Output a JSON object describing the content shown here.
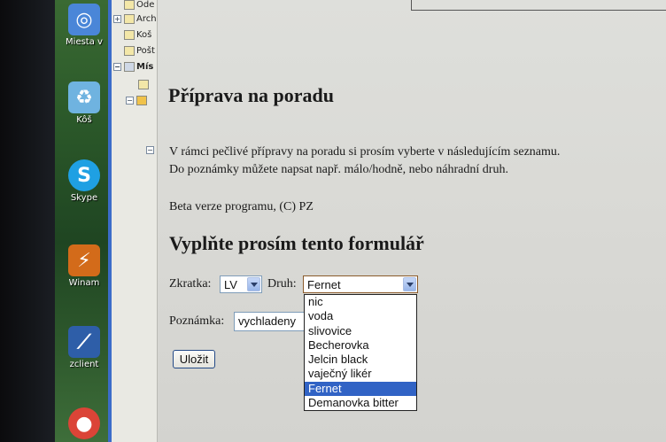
{
  "desktop": {
    "icons": [
      {
        "label": "Miesta v",
        "icon": "network-places-icon",
        "color": "#4a86d8"
      },
      {
        "label": "Kôš",
        "icon": "recycle-bin-icon",
        "color": "#6fb3e0"
      },
      {
        "label": "Skype",
        "icon": "skype-icon",
        "color": "#1fa0e3"
      },
      {
        "label": "Winam",
        "icon": "winamp-icon",
        "color": "#d36b1a"
      },
      {
        "label": "zclient",
        "icon": "zclient-icon",
        "color": "#2e5ea8"
      },
      {
        "label": "",
        "icon": "chrome-icon",
        "color": "#db4437"
      }
    ]
  },
  "tree": {
    "items": [
      {
        "label": "Ode",
        "expander": ""
      },
      {
        "label": "Arch",
        "expander": "+"
      },
      {
        "label": "Koš",
        "expander": ""
      },
      {
        "label": "Pošt",
        "expander": ""
      },
      {
        "label": "Mís",
        "expander": "−"
      },
      {
        "label": "",
        "expander": ""
      },
      {
        "label": "",
        "expander": "−"
      }
    ]
  },
  "page": {
    "title": "Příprava na poradu",
    "intro_line1": "V rámci pečlivé přípravy na poradu si prosím vyberte v následujícím seznamu.",
    "intro_line2": "Do poznámky můžete napsat např. málo/hodně, nebo náhradní druh.",
    "beta_note": "Beta verze programu, (C) PZ",
    "form_heading": "Vyplňte prosím tento formulář"
  },
  "form": {
    "zkratka_label": "Zkratka:",
    "zkratka_value": "LV",
    "druh_label": "Druh:",
    "druh_value": "Fernet",
    "druh_options": [
      "nic",
      "voda",
      "slivovice",
      "Becherovka",
      "Jelcin black",
      "vaječný likér",
      "Fernet",
      "Demanovka bitter"
    ],
    "druh_selected_index": 6,
    "poznamka_label": "Poznámka:",
    "poznamka_value": "vychladeny",
    "save_label": "Uložit"
  },
  "colors": {
    "selection": "#3163c5",
    "input_border": "#7f9db9",
    "taskbar_blue": "#3b6cc9"
  }
}
